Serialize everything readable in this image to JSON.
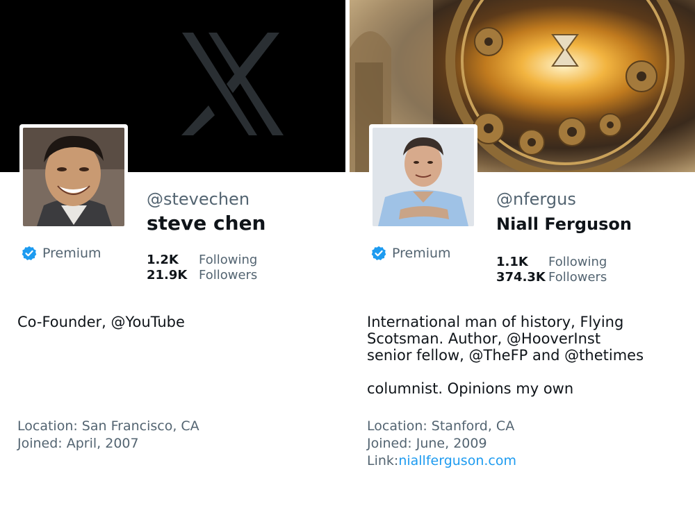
{
  "profiles": [
    {
      "handle": "@stevechen",
      "name": "steve chen",
      "premium": "Premium",
      "following_count": "1.2K",
      "following_label": "Following",
      "followers_count": "21.9K",
      "followers_label": "Followers",
      "bio": [
        "Co-Founder, @YouTube"
      ],
      "location": "Location: San Francisco, CA",
      "joined": "Joined: April, 2007",
      "banner_icon": "x-logo-icon"
    },
    {
      "handle": "@nfergus",
      "name": "Niall Ferguson",
      "premium": "Premium",
      "following_count": "1.1K",
      "following_label": "Following",
      "followers_count": "374.3K",
      "followers_label": "Followers",
      "bio_line1": "International man of history, Flying",
      "bio_line2": "Scotsman. Author, @HooverInst",
      "bio_line3": "senior fellow, @TheFP and @thetimes",
      "bio_line4": "columnist. Opinions my own",
      "location": "Location: Stanford, CA",
      "joined": "Joined: June, 2009",
      "link_label": "Link:",
      "link_text": "niallferguson.com"
    }
  ],
  "colors": {
    "verified_blue": "#1d9bf0",
    "muted_text": "#536471",
    "primary_text": "#0f1419"
  }
}
